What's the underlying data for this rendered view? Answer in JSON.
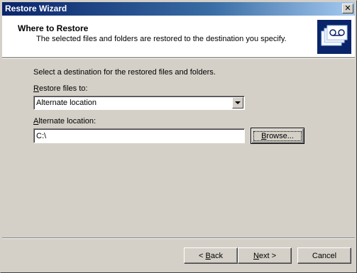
{
  "window": {
    "title": "Restore Wizard",
    "close_glyph": "✕"
  },
  "header": {
    "title": "Where to Restore",
    "subtitle": "The selected files and folders are restored to the destination you specify.",
    "icon": "restore-wizard-icon"
  },
  "main": {
    "instruction": "Select a destination for the restored files and folders.",
    "restore_to_label_first": "R",
    "restore_to_label_rest": "estore files to:",
    "restore_to_value": "Alternate location",
    "alt_label_first": "A",
    "alt_label_rest": "lternate location:",
    "alt_value": "C:\\",
    "browse_label_first": "B",
    "browse_label_rest": "rowse..."
  },
  "footer": {
    "back_prefix": "< ",
    "back_first": "B",
    "back_rest": "ack",
    "next_first": "N",
    "next_rest": "ext >",
    "cancel": "Cancel"
  }
}
